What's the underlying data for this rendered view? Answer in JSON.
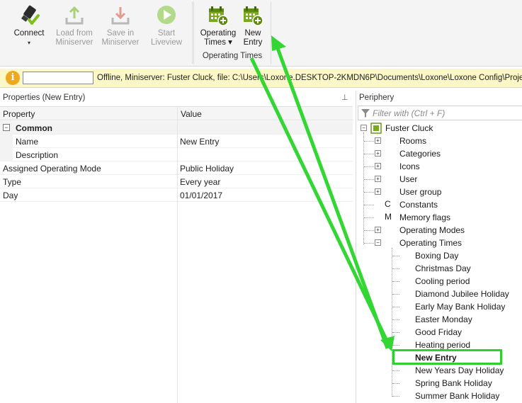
{
  "ribbon": {
    "buttons": [
      {
        "label": "Connect",
        "sub": "▾",
        "icon": "connect-plug-icon",
        "disabled": false
      },
      {
        "label": "Load from",
        "label2": "Miniserver",
        "icon": "load-from-miniserver-icon",
        "disabled": true
      },
      {
        "label": "Save in",
        "label2": "Miniserver",
        "icon": "save-in-miniserver-icon",
        "disabled": true
      },
      {
        "label": "Start",
        "label2": "Liveview",
        "icon": "play-icon",
        "disabled": true
      },
      {
        "label": "Operating",
        "label2": "Times ▾",
        "icon": "calendar-add-icon",
        "disabled": false
      },
      {
        "label": "New",
        "label2": "Entry",
        "icon": "calendar-add-icon",
        "disabled": false
      }
    ],
    "group_caption": "Operating Times"
  },
  "status": {
    "text": "Offline, Miniserver: Fuster Cluck, file: C:\\Users\\Loxone.DESKTOP-2KMDN6P\\Documents\\Loxone\\Loxone Config\\Projects"
  },
  "properties": {
    "title": "Properties (New Entry)",
    "col_property": "Property",
    "col_value": "Value",
    "category": "Common",
    "rows": [
      {
        "name": "Name",
        "value": "New Entry",
        "indent": true
      },
      {
        "name": "Description",
        "value": "",
        "indent": true
      },
      {
        "name": "Assigned Operating Mode",
        "value": "Public Holiday",
        "indent": false
      },
      {
        "name": "Type",
        "value": "Every year",
        "indent": false
      },
      {
        "name": "Day",
        "value": "01/01/2017",
        "indent": false
      }
    ]
  },
  "periphery": {
    "title": "Periphery",
    "filter_placeholder": "Filter with (Ctrl + F)",
    "root": "Fuster Cluck",
    "items": [
      {
        "label": "Rooms",
        "icon": "house-icon"
      },
      {
        "label": "Categories",
        "icon": "lightbulb-icon"
      },
      {
        "label": "Icons",
        "icon": "image-icon"
      },
      {
        "label": "User",
        "icon": "user-icon"
      },
      {
        "label": "User group",
        "icon": "user-group-icon"
      },
      {
        "label": "Constants",
        "icon": "constants-c-icon"
      },
      {
        "label": "Memory flags",
        "icon": "memory-flags-m-icon"
      },
      {
        "label": "Operating Modes",
        "icon": "gear-icon"
      },
      {
        "label": "Operating Times",
        "icon": "calendar-icon"
      }
    ],
    "operating_times": [
      "Boxing Day",
      "Christmas Day",
      "Cooling period",
      "Diamond Jubilee Holiday",
      "Early May Bank Holiday",
      "Easter Monday",
      "Good Friday",
      "Heating period",
      "New Entry",
      "New Years Day Holiday",
      "Spring Bank Holiday",
      "Summer Bank Holiday"
    ],
    "selected": "New Entry"
  },
  "colors": {
    "accent_green": "#2fcf2f",
    "calendar_green": "#7aa81e",
    "status_bg": "#fbf7c6",
    "info_orange": "#f0a81e"
  }
}
